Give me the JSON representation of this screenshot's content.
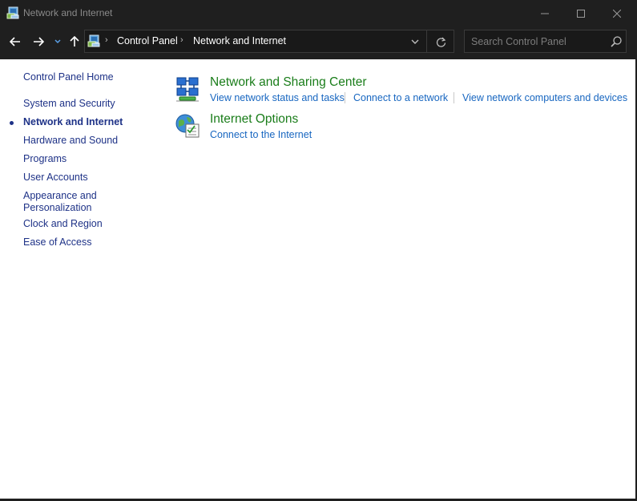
{
  "window": {
    "title": "Network and Internet"
  },
  "address": {
    "breadcrumbs": [
      "Control Panel",
      "Network and Internet"
    ]
  },
  "search": {
    "placeholder": "Search Control Panel"
  },
  "sidebar": {
    "home_label": "Control Panel Home",
    "items": [
      {
        "label": "System and Security"
      },
      {
        "label": "Network and Internet",
        "current": true
      },
      {
        "label": "Hardware and Sound"
      },
      {
        "label": "Programs"
      },
      {
        "label": "User Accounts"
      },
      {
        "label": "Appearance and",
        "label2": "Personalization"
      },
      {
        "label": "Clock and Region"
      },
      {
        "label": "Ease of Access"
      }
    ]
  },
  "categories": [
    {
      "title": "Network and Sharing Center",
      "icon": "network-sharing-center-icon",
      "tasks": [
        "View network status and tasks",
        "Connect to a network",
        "View network computers and devices"
      ]
    },
    {
      "title": "Internet Options",
      "icon": "internet-options-icon",
      "tasks": [
        "Connect to the Internet"
      ]
    }
  ],
  "colors": {
    "chrome": "#1f1f1f",
    "sidebar_link": "#1e3287",
    "category_title": "#1a7d1a",
    "task_link": "#1766c0"
  }
}
